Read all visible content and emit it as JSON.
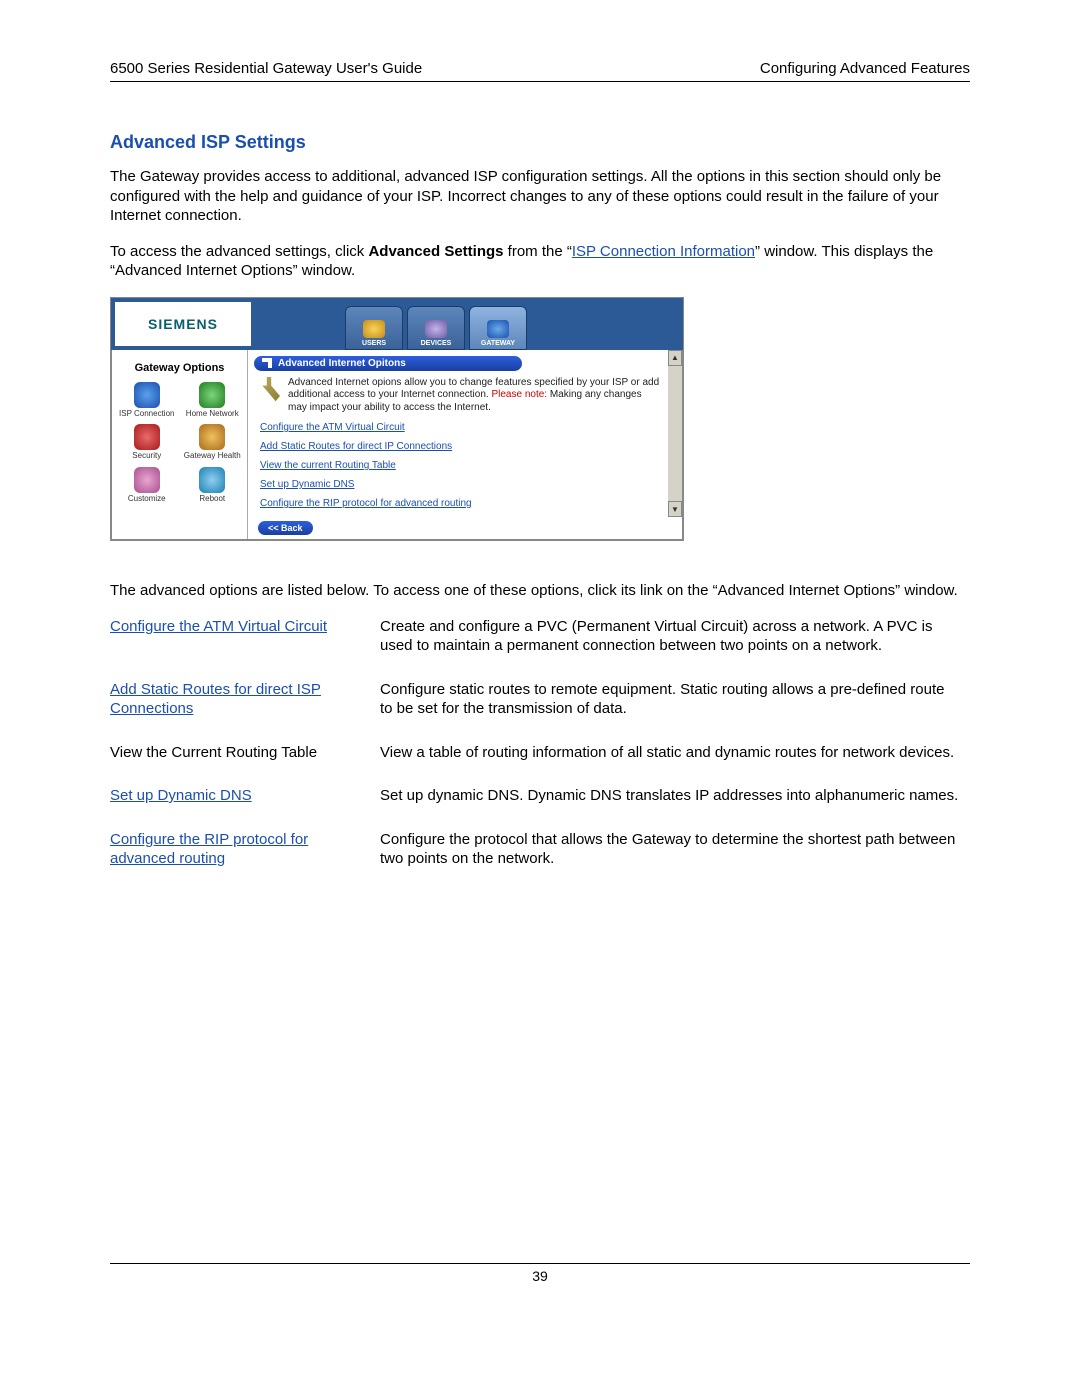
{
  "header": {
    "left": "6500 Series Residential Gateway User's Guide",
    "right": "Configuring Advanced Features"
  },
  "section_title": "Advanced ISP Settings",
  "para1": "The Gateway provides access to additional, advanced ISP configuration settings. All the options in this section should only be configured with the help and guidance of your ISP. Incorrect changes to any of these options could result in the failure of your Internet connection.",
  "para2_pre": "To access the advanced settings, click ",
  "para2_bold": "Advanced Settings",
  "para2_mid": " from the “",
  "para2_link": "ISP Connection Information",
  "para2_post": "” window. This displays the “Advanced Internet Options” window.",
  "ui": {
    "brand": "SIEMENS",
    "tabs": {
      "users": "USERS",
      "devices": "DEVICES",
      "gateway": "GATEWAY"
    },
    "sidebar": {
      "title": "Gateway Options",
      "items": [
        "ISP Connection",
        "Home Network",
        "Security",
        "Gateway Health",
        "Customize",
        "Reboot"
      ]
    },
    "panel": {
      "title": "Advanced Internet Opitons",
      "desc_pre": "Advanced Internet opions allow you to change features specified by your ISP or add additional access to your Internet connection. ",
      "desc_red": "Please note:",
      "desc_post": " Making any changes may impact your ability to access the Internet.",
      "links": [
        "Configure the ATM Virtual Circuit",
        "Add Static Routes for direct IP Connections",
        "View the current Routing Table",
        "Set up Dynamic DNS",
        "Configure the RIP protocol for advanced routing"
      ],
      "back": "<< Back"
    }
  },
  "below_ui": "The advanced options are listed below. To access one of these options, click its link on the “Advanced Internet Options” window.",
  "options": [
    {
      "label": "Configure the ATM Virtual Circuit",
      "is_link": true,
      "desc": "Create and configure a PVC (Permanent Virtual Circuit) across a network. A PVC is used to maintain a permanent connection between two points on a network."
    },
    {
      "label": "Add Static Routes for direct ISP Connections",
      "is_link": true,
      "desc": "Configure static routes to remote equipment. Static routing allows a pre-defined route to be set for the transmission of data."
    },
    {
      "label": "View the Current Routing Table",
      "is_link": false,
      "desc": "View a table of routing information of all static and dynamic routes for network devices."
    },
    {
      "label": "Set up Dynamic DNS",
      "is_link": true,
      "desc": "Set up dynamic DNS. Dynamic DNS translates IP addresses into alphanumeric names."
    },
    {
      "label": "Configure the RIP protocol for advanced routing",
      "is_link": true,
      "desc": "Configure the protocol that allows the Gateway to determine the shortest path between two points on the network."
    }
  ],
  "page_number": "39"
}
